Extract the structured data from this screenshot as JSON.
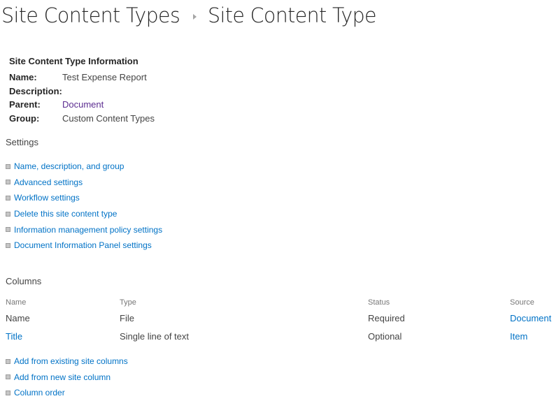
{
  "breadcrumb": {
    "parent": "Site Content Types",
    "separator_icon": "triangle-right",
    "current": "Site Content Type"
  },
  "info": {
    "heading": "Site Content Type Information",
    "rows": [
      {
        "label": "Name:",
        "value": "Test Expense Report",
        "is_link": false
      },
      {
        "label": "Description:",
        "value": "",
        "is_link": false
      },
      {
        "label": "Parent:",
        "value": "Document",
        "is_link": true
      },
      {
        "label": "Group:",
        "value": "Custom Content Types",
        "is_link": false
      }
    ]
  },
  "settings": {
    "title": "Settings",
    "links": [
      "Name, description, and group",
      "Advanced settings",
      "Workflow settings",
      "Delete this site content type",
      "Information management policy settings",
      "Document Information Panel settings"
    ]
  },
  "columns": {
    "title": "Columns",
    "headers": [
      "Name",
      "Type",
      "Status",
      "Source"
    ],
    "rows": [
      {
        "name": "Name",
        "name_is_link": false,
        "type": "File",
        "status": "Required",
        "source": "Document"
      },
      {
        "name": "Title",
        "name_is_link": true,
        "type": "Single line of text",
        "status": "Optional",
        "source": "Item"
      }
    ],
    "links": [
      "Add from existing site columns",
      "Add from new site column",
      "Column order"
    ]
  },
  "colors": {
    "link": "#0072c6",
    "visited_link": "#5c2d91",
    "text": "#444444",
    "heading": "#262626"
  }
}
